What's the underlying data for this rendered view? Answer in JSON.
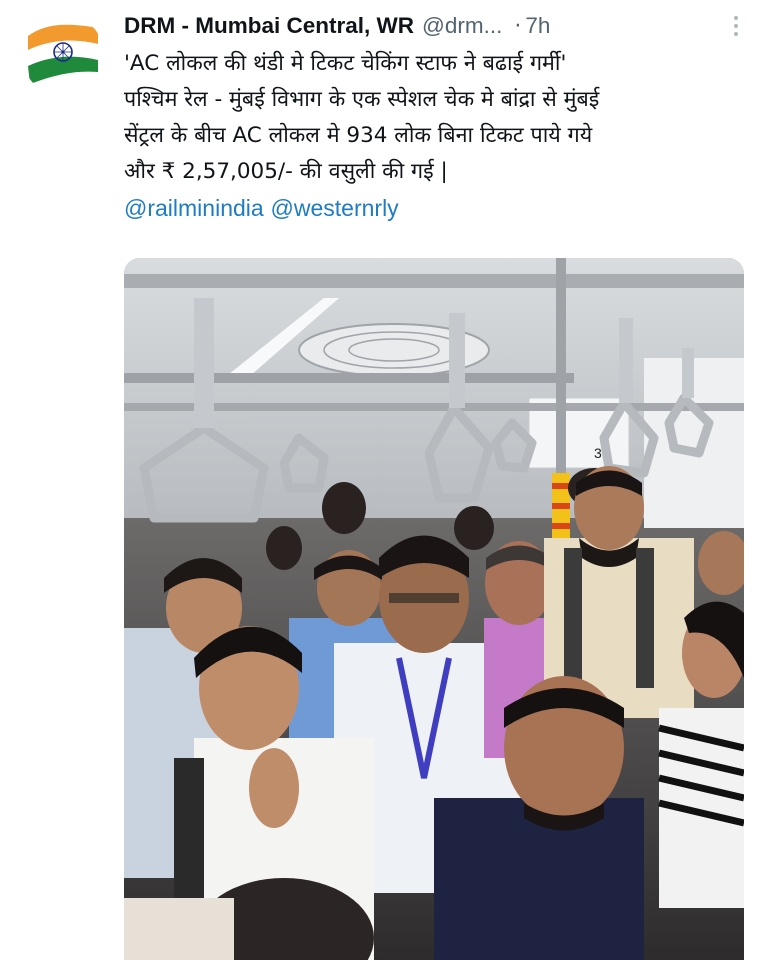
{
  "tweet": {
    "author_name": "DRM - Mumbai Central, WR",
    "handle": "@drm...",
    "separator": "·",
    "time": "7h",
    "text_lines": [
      "'AC लोकल की थंडी मे टिकट चेकिंग स्टाफ ने बढाई गर्मी'",
      "पश्चिम रेल - मुंबई विभाग के एक स्पेशल चेक मे बांद्रा से मुंबई",
      "सेंट्रल के बीच AC लोकल मे 934 लोक बिना टिकट पाये गये",
      "और ₹ 2,57,005/- की वसुली की गई |"
    ],
    "mentions": [
      "@railminindia",
      "@westernrly"
    ]
  },
  "avatar": {
    "icon": "indian-flag-icon",
    "colors": [
      "#ff9933",
      "#ffffff",
      "#138808",
      "#000080"
    ]
  },
  "photo": {
    "icon": "photo-crowded-ac-local-train",
    "badge_number": "3"
  },
  "colors": {
    "link": "#1d7cc4",
    "muted": "#536471",
    "text": "#0f1419"
  }
}
